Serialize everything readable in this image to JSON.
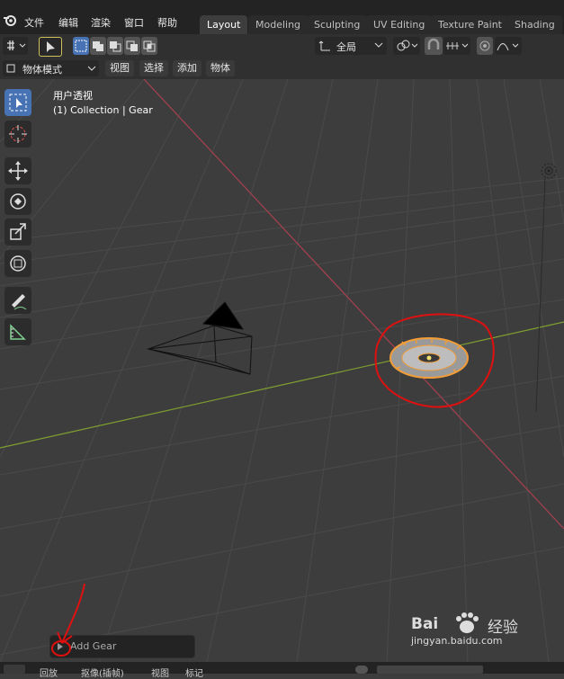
{
  "menu": {
    "file": "文件",
    "edit": "编辑",
    "render": "渲染",
    "window": "窗口",
    "help": "帮助"
  },
  "workspace_tabs": [
    {
      "label": "Layout",
      "active": true
    },
    {
      "label": "Modeling",
      "active": false
    },
    {
      "label": "Sculpting",
      "active": false
    },
    {
      "label": "UV Editing",
      "active": false
    },
    {
      "label": "Texture Paint",
      "active": false
    },
    {
      "label": "Shading",
      "active": false
    }
  ],
  "header": {
    "transform_orientation": "全局"
  },
  "mode_bar": {
    "mode": "物体模式",
    "view": "视图",
    "select": "选择",
    "add": "添加",
    "object": "物体"
  },
  "viewport": {
    "view_name": "用户透视",
    "collection_info": "(1) Collection | Gear"
  },
  "operator_panel": {
    "label": "Add Gear"
  },
  "bottom_bar": {
    "playback": "回放",
    "keying": "抠像(插帧)",
    "view": "视图",
    "marker": "标记"
  },
  "watermark": {
    "brand": "Bai",
    "brand_cn": "经验",
    "url": "jingyan.baidu.com"
  },
  "colors": {
    "accent_blue": "#4772b3",
    "selection_orange": "#f29d38",
    "annotation_red": "#e01010",
    "x_axis": "#c04050",
    "y_axis": "#7fa030"
  }
}
